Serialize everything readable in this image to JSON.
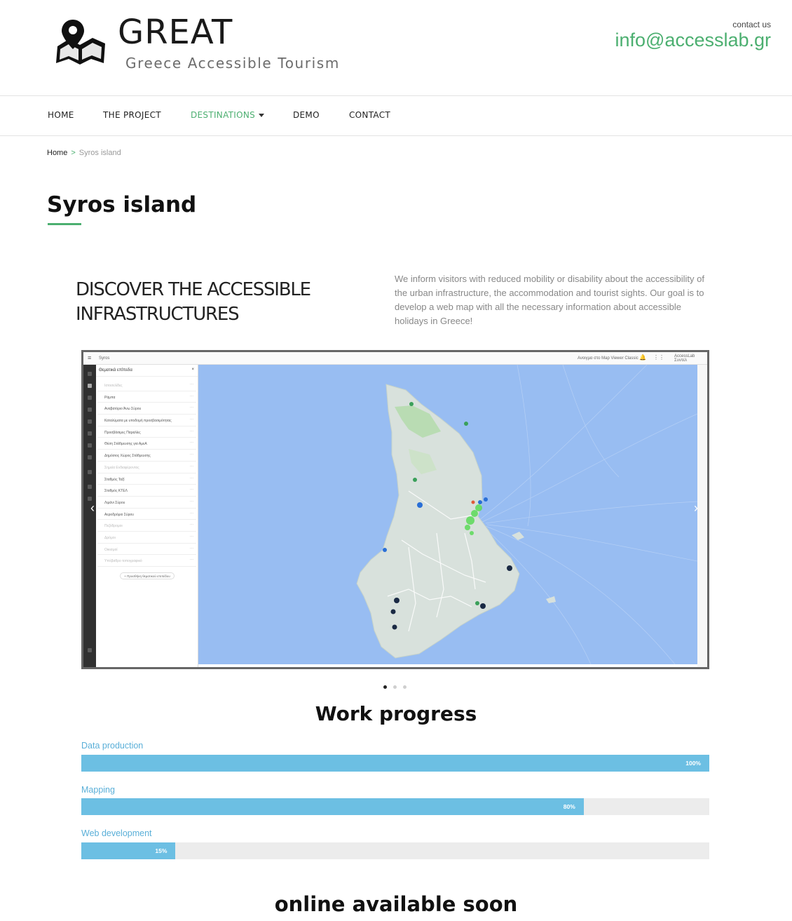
{
  "header": {
    "logo_title": "GREAT",
    "logo_subtitle": "Greece Accessible Tourism",
    "contact_label": "contact us",
    "contact_email": "info@accesslab.gr"
  },
  "nav": {
    "items": [
      {
        "label": "HOME"
      },
      {
        "label": "THE PROJECT"
      },
      {
        "label": "DESTINATIONS"
      },
      {
        "label": "DEMO"
      },
      {
        "label": "CONTACT"
      }
    ],
    "active": "DESTINATIONS"
  },
  "breadcrumb": {
    "home": "Home",
    "separator": ">",
    "current": "Syros island"
  },
  "page": {
    "title": "Syros island",
    "intro_heading": "Discover the accessible infrastructures",
    "intro_text": "We inform visitors with reduced mobility or disability about the accessibility of the urban infrastructure, the accommodation and tourist sights. Our goal is to develop a web map with all the necessary information about accessible holidays in Greece!"
  },
  "slider": {
    "app_title": "Syros",
    "app_top_right": "Ανοιγμα στο Map Viewer Classic",
    "app_user": "AccessLab",
    "app_user_role": "Συντελ",
    "panel_title": "Θεματικά επίπεδα",
    "layers": [
      {
        "name": "Ιστοσελίδες",
        "muted": true
      },
      {
        "name": "Ράμπα",
        "muted": false
      },
      {
        "name": "Αναβατόριο Άνω Σύρου",
        "muted": false
      },
      {
        "name": "Καταλύματα με υποδομή προσβασιμότητας",
        "muted": false
      },
      {
        "name": "Προσβάσιμες Παραλίες",
        "muted": false
      },
      {
        "name": "Θέση Στάθμευσης για ΑμεΑ",
        "muted": false
      },
      {
        "name": "Δημόσιος Χώρος Στάθμευσης",
        "muted": false
      },
      {
        "name": "Σημεία Ενδιαφέροντος",
        "muted": true
      },
      {
        "name": "Σταθμός Ταξί",
        "muted": false
      },
      {
        "name": "Σταθμός ΚΤΕΛ",
        "muted": false
      },
      {
        "name": "Λιμάνι Σύρου",
        "muted": false
      },
      {
        "name": "Αεροδρόμιο Σύρου",
        "muted": false
      },
      {
        "name": "Πεζόδρομοι",
        "muted": true
      },
      {
        "name": "Δρόμοι",
        "muted": true
      },
      {
        "name": "Οικισμοί",
        "muted": true
      },
      {
        "name": "Υπόβαθρο τοπογραφικό",
        "muted": true
      }
    ],
    "add_layer_label": "+ Προσθήκη θεματικού επιπέδου",
    "slide_count": 3,
    "active_slide": 1
  },
  "progress": {
    "title": "Work progress",
    "bars": [
      {
        "label": "Data production",
        "value": 100,
        "display": "100%"
      },
      {
        "label": "Mapping",
        "value": 80,
        "display": "80%"
      },
      {
        "label": "Web development",
        "value": 15,
        "display": "15%"
      }
    ]
  },
  "footer_note": "online available soon",
  "colors": {
    "accent": "#4caf70",
    "progress_fill": "#6cbfe3",
    "progress_track": "#ececec",
    "progress_label": "#5aafd8",
    "map_sea": "#98bdf2",
    "map_land": "#d8e1dc"
  }
}
